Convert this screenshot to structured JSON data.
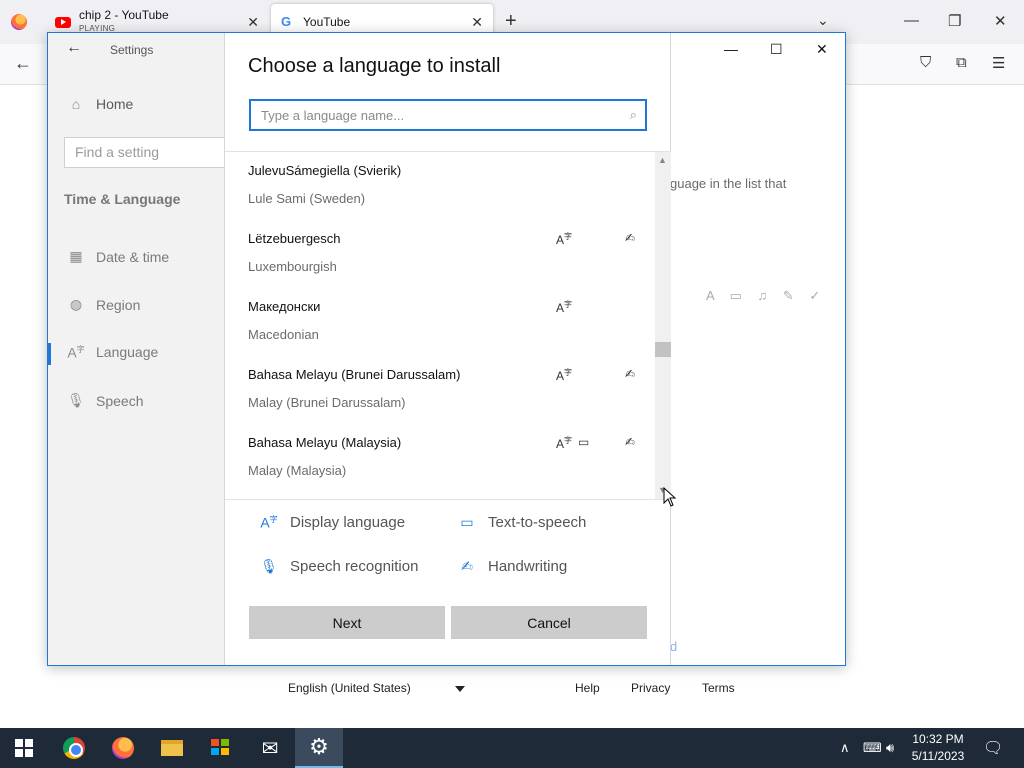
{
  "browser": {
    "tabs": [
      {
        "title": "chip 2 - YouTube",
        "subtitle": "PLAYING",
        "icon": "youtube-icon"
      },
      {
        "title": "YouTube",
        "icon": "google-icon"
      }
    ],
    "footer": {
      "language": "English (United States)",
      "links": [
        "Help",
        "Privacy",
        "Terms"
      ]
    }
  },
  "settings": {
    "title": "Settings",
    "home": "Home",
    "find_placeholder": "Find a setting",
    "section": "Time & Language",
    "nav": [
      {
        "label": "Date & time",
        "icon": "calendar-clock-icon"
      },
      {
        "label": "Region",
        "icon": "globe-icon"
      },
      {
        "label": "Language",
        "icon": "language-icon"
      },
      {
        "label": "Speech",
        "icon": "microphone-icon"
      }
    ],
    "behind_text": "guage in the list that",
    "behind_link": "d"
  },
  "dialog": {
    "title": "Choose a language to install",
    "search_placeholder": "Type a language name...",
    "languages": [
      {
        "name": "JulevuSámegiella (Svierik)",
        "english": "Lule Sami (Sweden)",
        "features": []
      },
      {
        "name": "Lëtzebuergesch",
        "english": "Luxembourgish",
        "features": [
          "display",
          "handwriting"
        ]
      },
      {
        "name": "Македонски",
        "english": "Macedonian",
        "features": [
          "display"
        ]
      },
      {
        "name": "Bahasa Melayu (Brunei Darussalam)",
        "english": "Malay (Brunei Darussalam)",
        "features": [
          "display",
          "handwriting"
        ]
      },
      {
        "name": "Bahasa Melayu (Malaysia)",
        "english": "Malay (Malaysia)",
        "features": [
          "display",
          "tts",
          "handwriting"
        ]
      }
    ],
    "legend": {
      "display": "Display language",
      "tts": "Text-to-speech",
      "speech": "Speech recognition",
      "handwriting": "Handwriting"
    },
    "next_label": "Next",
    "cancel_label": "Cancel"
  },
  "taskbar": {
    "time": "10:32 PM",
    "date": "5/11/2023"
  },
  "colors": {
    "accent": "#1e78d7",
    "taskbar": "#1f2a38",
    "button": "#cccccc"
  }
}
